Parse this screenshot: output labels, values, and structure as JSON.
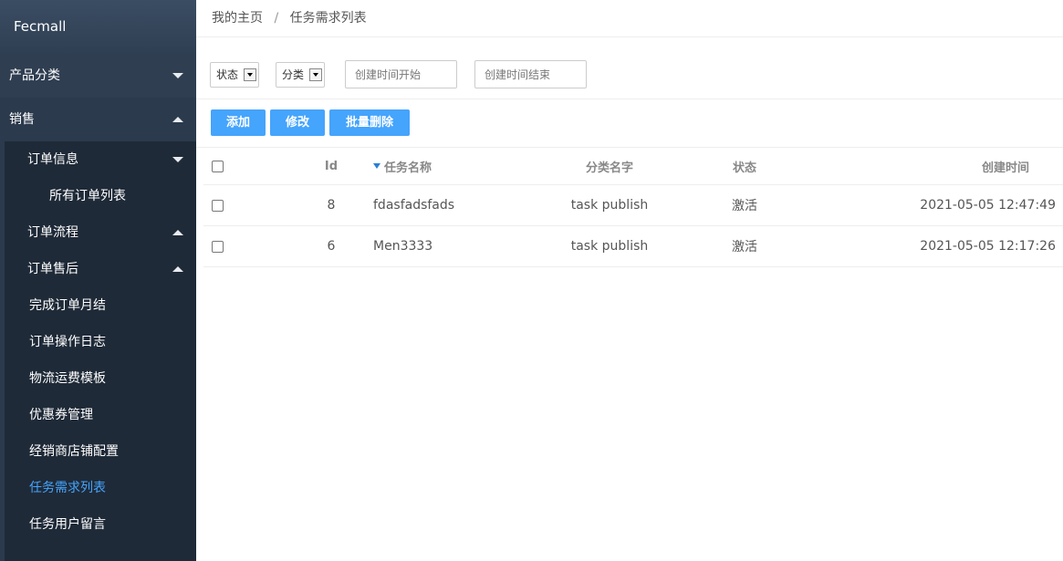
{
  "app": {
    "name": "Fecmall"
  },
  "sidebar": {
    "top_items": [
      {
        "label": "产品分类",
        "expanded": false
      },
      {
        "label": "销售",
        "expanded": true
      }
    ],
    "sub_items": [
      {
        "label": "订单信息",
        "expanded": true
      },
      {
        "label": "所有订单列表"
      },
      {
        "label": "订单流程",
        "expanded": false
      },
      {
        "label": "订单售后",
        "expanded": false
      },
      {
        "label": "完成订单月结"
      },
      {
        "label": "订单操作日志"
      },
      {
        "label": "物流运费模板"
      },
      {
        "label": "优惠券管理"
      },
      {
        "label": "经销商店铺配置"
      },
      {
        "label": "任务需求列表",
        "active": true
      },
      {
        "label": "任务用户留言"
      }
    ],
    "active_color": "#45a4fc"
  },
  "breadcrumb": {
    "home": "我的主页",
    "separator": "/",
    "current": "任务需求列表"
  },
  "filters": {
    "status_label": "状态",
    "category_label": "分类",
    "created_start_placeholder": "创建时间开始",
    "created_end_placeholder": "创建时间结束"
  },
  "toolbar": {
    "add": "添加",
    "edit": "修改",
    "batch_delete": "批量删除",
    "button_color": "#45a4fc"
  },
  "table": {
    "columns": {
      "id": "Id",
      "name": "任务名称",
      "category": "分类名字",
      "status": "状态",
      "created": "创建时间"
    },
    "sort_column": "name",
    "rows": [
      {
        "id": "8",
        "name": "fdasfadsfads",
        "category": "task publish",
        "status": "激活",
        "created": "2021-05-05 12:47:49"
      },
      {
        "id": "6",
        "name": "Men3333",
        "category": "task publish",
        "status": "激活",
        "created": "2021-05-05 12:17:26"
      }
    ]
  },
  "icons": {
    "collapse": "caret-down-icon",
    "expand": "caret-up-icon",
    "dropdown": "dropdown-arrow-icon",
    "sort": "sort-desc-icon"
  }
}
